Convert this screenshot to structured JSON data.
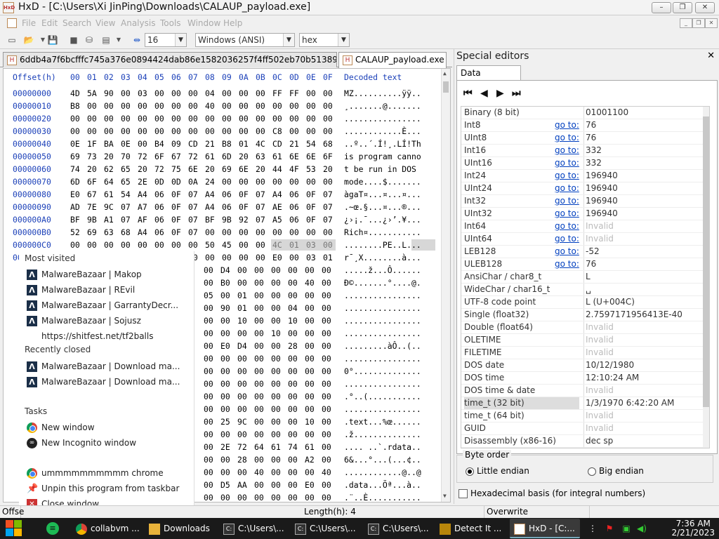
{
  "window": {
    "title": "HxD - [C:\\Users\\Xi JinPing\\Downloads\\CALAUP_payload.exe]",
    "app_icon": "HxD",
    "minimize": "–",
    "maximize": "❐",
    "close": "✕"
  },
  "menu": [
    "File",
    "Edit",
    "Search",
    "View",
    "Analysis",
    "Tools",
    "Window",
    "Help"
  ],
  "toolbar": {
    "bytes_per_row": "16",
    "charset": "Windows (ANSI)",
    "offset_base": "hex"
  },
  "tabs": [
    {
      "label": "6ddb4a7f6bcfffc745a376e0894424dab86e1582036257f4ff502eb70b51389e.exe",
      "active": false
    },
    {
      "label": "CALAUP_payload.exe",
      "active": true
    }
  ],
  "hex_view": {
    "header": {
      "offset": "Offset(h)",
      "columns": [
        "00",
        "01",
        "02",
        "03",
        "04",
        "05",
        "06",
        "07",
        "08",
        "09",
        "0A",
        "0B",
        "0C",
        "0D",
        "0E",
        "0F"
      ],
      "decoded": "Decoded text"
    },
    "rows": [
      {
        "offset": "00000000",
        "bytes": "4D 5A 90 00 03 00 00 00 04 00 00 00 FF FF 00 00",
        "text": "MZ..........ÿÿ.."
      },
      {
        "offset": "00000010",
        "bytes": "B8 00 00 00 00 00 00 00 40 00 00 00 00 00 00 00",
        "text": "¸.......@......."
      },
      {
        "offset": "00000020",
        "bytes": "00 00 00 00 00 00 00 00 00 00 00 00 00 00 00 00",
        "text": "................"
      },
      {
        "offset": "00000030",
        "bytes": "00 00 00 00 00 00 00 00 00 00 00 00 C8 00 00 00",
        "text": "............È..."
      },
      {
        "offset": "00000040",
        "bytes": "0E 1F BA 0E 00 B4 09 CD 21 B8 01 4C CD 21 54 68",
        "text": "..º..´.Í!¸.LÍ!Th"
      },
      {
        "offset": "00000050",
        "bytes": "69 73 20 70 72 6F 67 72 61 6D 20 63 61 6E 6E 6F",
        "text": "is program canno"
      },
      {
        "offset": "00000060",
        "bytes": "74 20 62 65 20 72 75 6E 20 69 6E 20 44 4F 53 20",
        "text": "t be run in DOS "
      },
      {
        "offset": "00000070",
        "bytes": "6D 6F 64 65 2E 0D 0D 0A 24 00 00 00 00 00 00 00",
        "text": "mode....$......."
      },
      {
        "offset": "00000080",
        "bytes": "E0 67 61 54 A4 06 0F 07 A4 06 0F 07 A4 06 0F 07",
        "text": "àgaT¤...¤...¤..."
      },
      {
        "offset": "00000090",
        "bytes": "AD 7E 9C 07 A7 06 0F 07 A4 06 0F 07 AE 06 0F 07",
        "text": ".~œ.§...¤...®..."
      },
      {
        "offset": "000000A0",
        "bytes": "BF 9B A1 07 AF 06 0F 07 BF 9B 92 07 A5 06 0F 07",
        "text": "¿›¡.¯...¿›’.¥..."
      },
      {
        "offset": "000000B0",
        "bytes": "52 69 63 68 A4 06 0F 07 00 00 00 00 00 00 00 00",
        "text": "Rich¤..........."
      },
      {
        "offset": "000000C0",
        "bytes": "00 00 00 00 00 00 00 00 50 45 00 00 4C 01 03 00",
        "text": "........PE..L..."
      },
      {
        "offset": "000000D0",
        "bytes": "72 AF B8 58 00 00 00 00 00 00 00 00 E0 00 03 01",
        "text": "r¯¸X........à..."
      }
    ],
    "partial_rows": [
      {
        "bytes": "00 D4 00 00 00 00 00 00",
        "text": ".....ž...Ô......"
      },
      {
        "bytes": "00 B0 00 00 00 00 40 00",
        "text": "Ð©.......°....@."
      },
      {
        "bytes": "05 00 01 00 00 00 00 00",
        "text": "................"
      },
      {
        "bytes": "00 90 01 00 00 04 00 00",
        "text": "................"
      },
      {
        "bytes": "00 00 10 00 00 10 00 00",
        "text": "................"
      },
      {
        "bytes": "00 00 00 00 10 00 00 00",
        "text": "................"
      },
      {
        "bytes": "00 E0 D4 00 00 28 00 00",
        "text": ".........àÔ..(.."
      },
      {
        "bytes": "00 00 00 00 00 00 00 00",
        "text": "................"
      },
      {
        "bytes": "00 00 00 00 00 00 00 00",
        "text": "0°.............."
      },
      {
        "bytes": "00 00 00 00 00 00 00 00",
        "text": "................"
      },
      {
        "bytes": "00 00 00 00 00 00 00 00",
        "text": ".°..(..........."
      },
      {
        "bytes": "00 00 00 00 00 00 00 00",
        "text": "................"
      },
      {
        "bytes": "00 25 9C 00 00 00 10 00",
        "text": ".text...%œ......"
      },
      {
        "bytes": "00 00 00 00 00 00 00 00",
        "text": ".ž.............."
      },
      {
        "bytes": "00 2E 72 64 61 74 61 00",
        "text": ".... ..`.rdata.."
      },
      {
        "bytes": "00 00 28 00 00 00 A2 00",
        "text": "6&...°...(...¢.."
      },
      {
        "bytes": "00 00 00 40 00 00 00 40",
        "text": "............@..@"
      },
      {
        "bytes": "00 D5 AA 00 00 00 E0 00",
        "text": ".data...Õª...à.."
      },
      {
        "bytes": "00 00 00 00 00 00 00 00",
        "text": ".¨..È..........."
      },
      {
        "bytes": "00 00 00 00 00 00 00 00",
        "text": "....@..À........"
      }
    ]
  },
  "jumplist": {
    "most_visited_title": "Most visited",
    "most_visited": [
      "MalwareBazaar | Makop",
      "MalwareBazaar | REvil",
      "MalwareBazaar | GarrantyDecr...",
      "MalwareBazaar | Sojusz",
      "https://shitfest.net/tf2balls"
    ],
    "recently_closed_title": "Recently closed",
    "recently_closed": [
      "MalwareBazaar | Download ma...",
      "MalwareBazaar | Download ma..."
    ],
    "tasks_title": "Tasks",
    "tasks": [
      "New window",
      "New Incognito window"
    ],
    "app_items": [
      "ummmmmmmmmm chrome",
      "Unpin this program from taskbar",
      "Close window"
    ],
    "mb_icon_letter": "Λ"
  },
  "special_editors": {
    "title": "Special editors",
    "close": "✕",
    "tab": "Data inspector",
    "nav": [
      "⏮",
      "◀",
      "▶",
      "⏭"
    ],
    "rows": [
      {
        "name": "Binary (8 bit)",
        "goto": "",
        "value": "01001100",
        "invalid": false
      },
      {
        "name": "Int8",
        "goto": "go to:",
        "value": "76",
        "invalid": false
      },
      {
        "name": "UInt8",
        "goto": "go to:",
        "value": "76",
        "invalid": false
      },
      {
        "name": "Int16",
        "goto": "go to:",
        "value": "332",
        "invalid": false
      },
      {
        "name": "UInt16",
        "goto": "go to:",
        "value": "332",
        "invalid": false
      },
      {
        "name": "Int24",
        "goto": "go to:",
        "value": "196940",
        "invalid": false
      },
      {
        "name": "UInt24",
        "goto": "go to:",
        "value": "196940",
        "invalid": false
      },
      {
        "name": "Int32",
        "goto": "go to:",
        "value": "196940",
        "invalid": false
      },
      {
        "name": "UInt32",
        "goto": "go to:",
        "value": "196940",
        "invalid": false
      },
      {
        "name": "Int64",
        "goto": "go to:",
        "value": "Invalid",
        "invalid": true
      },
      {
        "name": "UInt64",
        "goto": "go to:",
        "value": "Invalid",
        "invalid": true
      },
      {
        "name": "LEB128",
        "goto": "go to:",
        "value": "-52",
        "invalid": false
      },
      {
        "name": "ULEB128",
        "goto": "go to:",
        "value": "76",
        "invalid": false
      },
      {
        "name": "AnsiChar / char8_t",
        "goto": "",
        "value": "L",
        "invalid": false
      },
      {
        "name": "WideChar / char16_t",
        "goto": "",
        "value": "␣",
        "invalid": false
      },
      {
        "name": "UTF-8 code point",
        "goto": "",
        "value": "L (U+004C)",
        "invalid": false
      },
      {
        "name": "Single (float32)",
        "goto": "",
        "value": "2.7597171956413E-40",
        "invalid": false
      },
      {
        "name": "Double (float64)",
        "goto": "",
        "value": "Invalid",
        "invalid": true
      },
      {
        "name": "OLETIME",
        "goto": "",
        "value": "Invalid",
        "invalid": true
      },
      {
        "name": "FILETIME",
        "goto": "",
        "value": "Invalid",
        "invalid": true
      },
      {
        "name": "DOS date",
        "goto": "",
        "value": "10/12/1980",
        "invalid": false
      },
      {
        "name": "DOS time",
        "goto": "",
        "value": "12:10:24 AM",
        "invalid": false
      },
      {
        "name": "DOS time & date",
        "goto": "",
        "value": "Invalid",
        "invalid": true
      },
      {
        "name": "time_t (32 bit)",
        "goto": "",
        "value": "1/3/1970 6:42:20 AM",
        "invalid": false,
        "selected": true
      },
      {
        "name": "time_t (64 bit)",
        "goto": "",
        "value": "Invalid",
        "invalid": true
      },
      {
        "name": "GUID",
        "goto": "",
        "value": "Invalid",
        "invalid": true
      },
      {
        "name": "Disassembly (x86-16)",
        "goto": "",
        "value": "dec sp",
        "invalid": false
      }
    ],
    "byte_order": {
      "label": "Byte order",
      "little": "Little endian",
      "big": "Big endian",
      "selected": "little"
    },
    "hex_basis": "Hexadecimal basis (for integral numbers)"
  },
  "status": {
    "offset": "Offse",
    "length": "Length(h): 4",
    "mode": "Overwrite"
  },
  "taskbar": {
    "items": [
      {
        "label": "collabvm ...",
        "icon": "chrome",
        "active": false
      },
      {
        "label": "Downloads",
        "icon": "folder",
        "active": false
      },
      {
        "label": "C:\\Users\\...",
        "icon": "terminal",
        "active": false
      },
      {
        "label": "C:\\Users\\...",
        "icon": "terminal",
        "active": false
      },
      {
        "label": "C:\\Users\\...",
        "icon": "terminal",
        "active": false
      },
      {
        "label": "Detect It ...",
        "icon": "die",
        "active": false
      },
      {
        "label": "HxD - [C:...",
        "icon": "hxd",
        "active": true
      }
    ],
    "time": "7:36 AM",
    "date": "2/21/2023"
  }
}
